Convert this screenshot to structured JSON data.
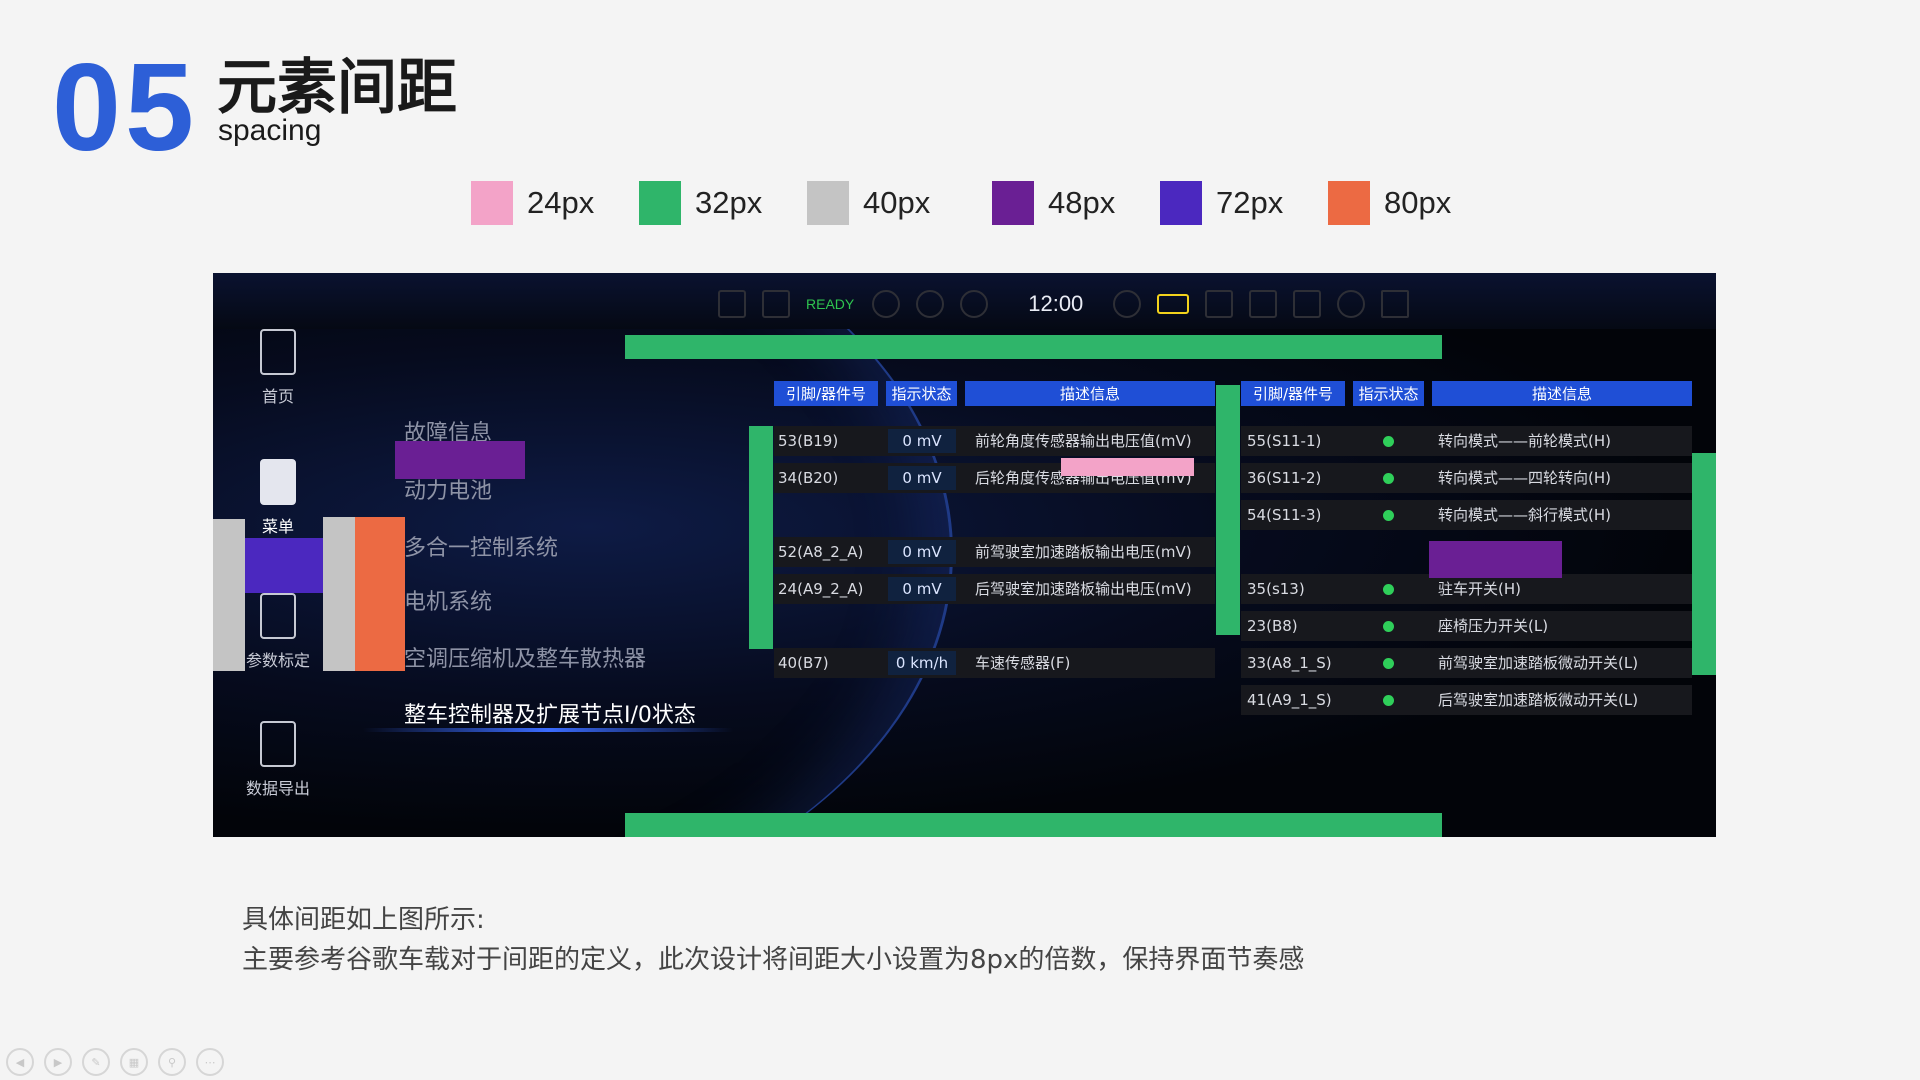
{
  "header": {
    "number": "05",
    "title_cn": "元素间距",
    "title_en": "spacing"
  },
  "legend": [
    {
      "label": "24px",
      "color": "#f3a3c8"
    },
    {
      "label": "32px",
      "color": "#2fb56a"
    },
    {
      "label": "40px",
      "color": "#c4c4c4"
    },
    {
      "label": "48px",
      "color": "#6a1f94"
    },
    {
      "label": "72px",
      "color": "#4b28bf"
    },
    {
      "label": "80px",
      "color": "#ec6a43"
    }
  ],
  "screen": {
    "status_bar": {
      "ready": "READY",
      "time": "12:00"
    },
    "sidebar": [
      {
        "label": "首页",
        "icon": "steering-wheel-icon"
      },
      {
        "label": "菜单",
        "icon": "document-list-icon"
      },
      {
        "label": "参数标定",
        "icon": "calibration-icon"
      },
      {
        "label": "数据导出",
        "icon": "export-icon"
      }
    ],
    "menu": [
      "故障信息",
      "动力电池",
      "多合一控制系统",
      "电机系统",
      "空调压缩机及整车散热器",
      "整车控制器及扩展节点I/0状态"
    ],
    "left_table": {
      "headers": [
        "引脚/器件号",
        "指示状态",
        "描述信息"
      ],
      "rows": [
        {
          "pin": "53(B19)",
          "value": "0 mV",
          "desc": "前轮角度传感器输出电压值(mV)"
        },
        {
          "pin": "34(B20)",
          "value": "0 mV",
          "desc": "后轮角度传感器输出电压值(mV)"
        },
        {
          "pin": "52(A8_2_A)",
          "value": "0 mV",
          "desc": "前驾驶室加速踏板输出电压(mV)"
        },
        {
          "pin": "24(A9_2_A)",
          "value": "0 mV",
          "desc": "后驾驶室加速踏板输出电压(mV)"
        },
        {
          "pin": "40(B7)",
          "value": "0 km/h",
          "desc": "车速传感器(F)"
        }
      ]
    },
    "right_table": {
      "headers": [
        "引脚/器件号",
        "指示状态",
        "描述信息"
      ],
      "rows": [
        {
          "pin": "55(S11-1)",
          "desc": "转向模式——前轮模式(H)"
        },
        {
          "pin": "36(S11-2)",
          "desc": "转向模式——四轮转向(H)"
        },
        {
          "pin": "54(S11-3)",
          "desc": "转向模式——斜行模式(H)"
        },
        {
          "pin": "35(s13)",
          "desc": "驻车开关(H)"
        },
        {
          "pin": "23(B8)",
          "desc": "座椅压力开关(L)"
        },
        {
          "pin": "33(A8_1_S)",
          "desc": "前驾驶室加速踏板微动开关(L)"
        },
        {
          "pin": "41(A9_1_S)",
          "desc": "后驾驶室加速踏板微动开关(L)"
        }
      ],
      "indicator_color": "#2fcf5a"
    }
  },
  "notes": {
    "line1": "具体间距如上图所示:",
    "line2": "主要参考谷歌车载对于间距的定义，此次设计将间距大小设置为8px的倍数，保持界面节奏感"
  }
}
